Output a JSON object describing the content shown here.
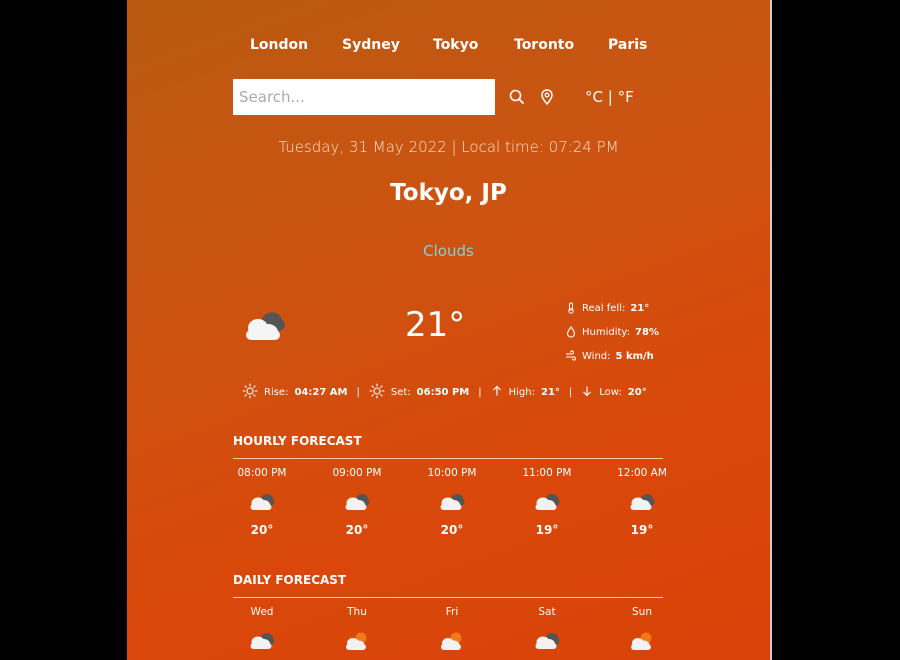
{
  "cities": [
    "London",
    "Sydney",
    "Tokyo",
    "Toronto",
    "Paris"
  ],
  "search": {
    "placeholder": "Search..."
  },
  "units": {
    "celsius": "°C",
    "separator": "|",
    "fahrenheit": "°F"
  },
  "datetime": "Tuesday, 31 May 2022 | Local time: 07:24 PM",
  "location": "Tokyo, JP",
  "condition": "Clouds",
  "temperature": "21°",
  "details": {
    "real_feel_label": "Real fell:",
    "real_feel_value": "21°",
    "humidity_label": "Humidity:",
    "humidity_value": "78%",
    "wind_label": "Wind:",
    "wind_value": "5 km/h"
  },
  "astro": {
    "rise_label": "Rise:",
    "rise_value": "04:27 AM",
    "set_label": "Set:",
    "set_value": "06:50 PM",
    "high_label": "High:",
    "high_value": "21°",
    "low_label": "Low:",
    "low_value": "20°",
    "separator": "|"
  },
  "hourly": {
    "title": "HOURLY FORECAST",
    "items": [
      {
        "label": "08:00 PM",
        "temp": "20°",
        "icon": "clouds-icon"
      },
      {
        "label": "09:00 PM",
        "temp": "20°",
        "icon": "clouds-icon"
      },
      {
        "label": "10:00 PM",
        "temp": "20°",
        "icon": "clouds-icon"
      },
      {
        "label": "11:00 PM",
        "temp": "19°",
        "icon": "clouds-icon"
      },
      {
        "label": "12:00 AM",
        "temp": "19°",
        "icon": "clouds-icon"
      }
    ]
  },
  "daily": {
    "title": "DAILY FORECAST",
    "items": [
      {
        "label": "Wed",
        "icon": "clouds-icon"
      },
      {
        "label": "Thu",
        "icon": "sun-cloud-icon"
      },
      {
        "label": "Fri",
        "icon": "sun-cloud-icon"
      },
      {
        "label": "Sat",
        "icon": "clouds-icon"
      },
      {
        "label": "Sun",
        "icon": "sun-cloud-icon"
      }
    ]
  },
  "colors": {
    "background_start": "#b85a10",
    "background_end": "#d94209",
    "condition_text": "#7dd3d8"
  }
}
